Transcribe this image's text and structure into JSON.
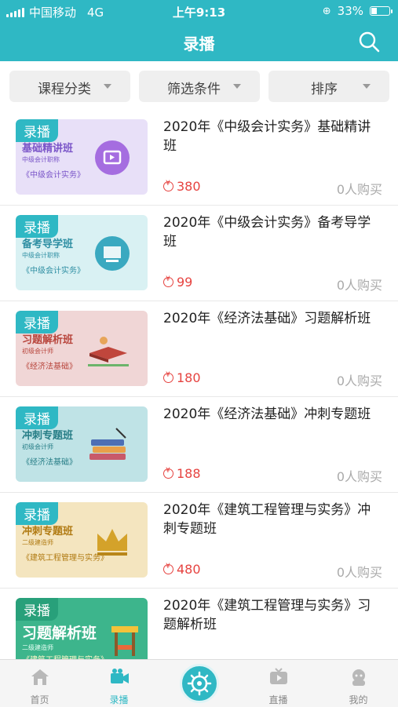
{
  "status": {
    "carrier": "中国移动",
    "network": "4G",
    "time": "上午9:13",
    "battery": "33%",
    "battery_level": 0.33
  },
  "nav": {
    "title": "录播",
    "search_icon": "search-icon"
  },
  "filters": [
    {
      "label": "课程分类"
    },
    {
      "label": "筛选条件"
    },
    {
      "label": "排序"
    }
  ],
  "courses": [
    {
      "tag": "录播",
      "thumb_title": "基础精讲班",
      "thumb_sub": "中级会计职称",
      "thumb_book": "《中级会计实务》",
      "name": "2020年《中级会计实务》基础精讲班",
      "price": "380",
      "buyers": "0人购买",
      "bg": "#e8e0f8",
      "accent": "#7a55c8"
    },
    {
      "tag": "录播",
      "thumb_title": "备考导学班",
      "thumb_sub": "中级会计职称",
      "thumb_book": "《中级会计实务》",
      "name": "2020年《中级会计实务》备考导学班",
      "price": "99",
      "buyers": "0人购买",
      "bg": "#d9f1f3",
      "accent": "#2f8fa3"
    },
    {
      "tag": "录播",
      "thumb_title": "习题解析班",
      "thumb_sub": "初级会计师",
      "thumb_book": "《经济法基础》",
      "name": "2020年《经济法基础》习题解析班",
      "price": "180",
      "buyers": "0人购买",
      "bg": "#f0d6d6",
      "accent": "#b8453c"
    },
    {
      "tag": "录播",
      "thumb_title": "冲刺专题班",
      "thumb_sub": "初级会计师",
      "thumb_book": "《经济法基础》",
      "name": "2020年《经济法基础》冲刺专题班",
      "price": "188",
      "buyers": "0人购买",
      "bg": "#bfe3e6",
      "accent": "#267d86"
    },
    {
      "tag": "录播",
      "thumb_title": "冲刺专题班",
      "thumb_sub": "二级建造师",
      "thumb_book": "《建筑工程管理与实务》",
      "name": "2020年《建筑工程管理与实务》冲刺专题班",
      "price": "480",
      "buyers": "0人购买",
      "bg": "#f4e5bf",
      "accent": "#b07a12"
    },
    {
      "tag": "录播",
      "thumb_title": "习题解析班",
      "thumb_sub": "二级建造师",
      "thumb_book": "《建筑工程管理与实务》",
      "name": "2020年《建筑工程管理与实务》习题解析班",
      "price": "",
      "buyers": "",
      "bg": "#3db58c",
      "accent": "#ffffff"
    }
  ],
  "tabs": [
    {
      "label": "首页",
      "icon": "home-icon"
    },
    {
      "label": "录播",
      "icon": "video-camera-icon",
      "active": true
    },
    {
      "label": "",
      "icon": "helm-icon"
    },
    {
      "label": "直播",
      "icon": "tv-icon"
    },
    {
      "label": "我的",
      "icon": "profile-icon"
    }
  ],
  "colors": {
    "primary": "#2fb8c4",
    "price": "#e64340"
  }
}
